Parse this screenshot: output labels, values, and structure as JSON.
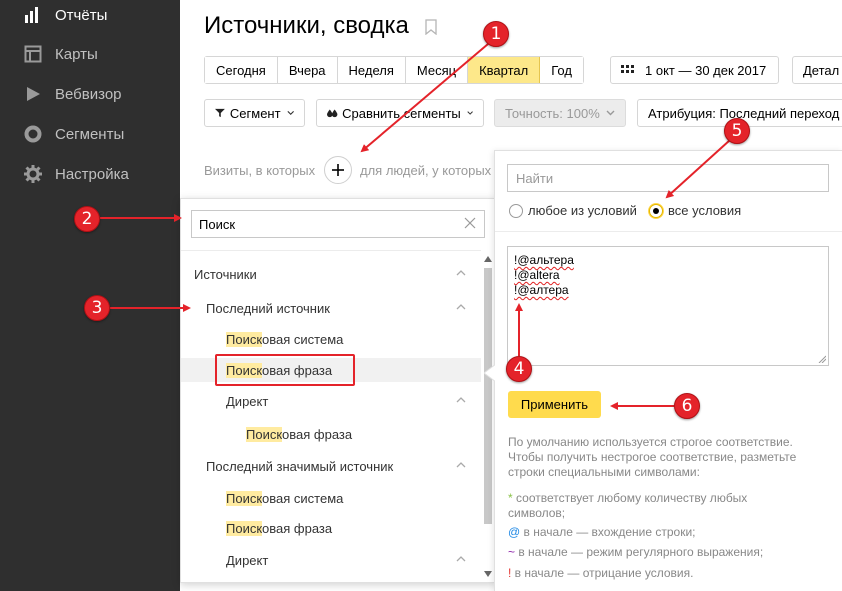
{
  "sidebar": {
    "items": [
      {
        "label": "Отчёты",
        "icon": "bar-chart-icon",
        "active": true
      },
      {
        "label": "Карты",
        "icon": "map-icon",
        "active": false
      },
      {
        "label": "Вебвизор",
        "icon": "play-icon",
        "active": false
      },
      {
        "label": "Сегменты",
        "icon": "pie-icon",
        "active": false
      },
      {
        "label": "Настройка",
        "icon": "gear-icon",
        "active": false
      }
    ]
  },
  "header": {
    "title": "Источники, сводка",
    "periods": [
      "Сегодня",
      "Вчера",
      "Неделя",
      "Месяц",
      "Квартал",
      "Год"
    ],
    "active_period": "Квартал",
    "date_range": "1 окт — 30 дек 2017",
    "detail_label": "Детал"
  },
  "toolbar": {
    "segment_label": "Сегмент",
    "compare_label": "Сравнить сегменты",
    "accuracy_label": "Точность: 100%",
    "attribution_label": "Атрибуция: Последний переход"
  },
  "filter": {
    "visits_caption": "Визиты, в которых",
    "people_caption": "для людей, у которых"
  },
  "dropdown": {
    "search_value": "Поиск",
    "items": [
      {
        "pre": "",
        "match": "",
        "post": "Источники"
      },
      {
        "pre": "",
        "match": "",
        "post": "Последний источник"
      },
      {
        "pre": "",
        "match": "Поиск",
        "post": "овая система"
      },
      {
        "pre": "",
        "match": "Поиск",
        "post": "овая фраза"
      },
      {
        "pre": "",
        "match": "",
        "post": "Директ"
      },
      {
        "pre": "",
        "match": "Поиск",
        "post": "овая фраза"
      },
      {
        "pre": "",
        "match": "",
        "post": "Последний значимый источник"
      },
      {
        "pre": "",
        "match": "Поиск",
        "post": "овая система"
      },
      {
        "pre": "",
        "match": "Поиск",
        "post": "овая фраза"
      },
      {
        "pre": "",
        "match": "",
        "post": "Директ"
      }
    ]
  },
  "panel": {
    "find_placeholder": "Найти",
    "radio_any": "любое из условий",
    "radio_all": "все условия",
    "selected_radio": "все условия",
    "conditions": [
      "!@альтера",
      "!@altera",
      "!@алтера"
    ],
    "apply_label": "Применить",
    "help_intro": "По умолчанию используется строгое соответствие. Чтобы получить нестрогое соответствие, разметьте строки специальными символами:",
    "help_rules": [
      {
        "symbol": "*",
        "text": " соответствует любому количеству любых символов;",
        "color": "#8bc34a"
      },
      {
        "symbol": "@",
        "text": " в начале — вхождение строки;",
        "color": "#1e88e5"
      },
      {
        "symbol": "~",
        "text": " в начале — режим регулярного выражения;",
        "color": "#8e24aa"
      },
      {
        "symbol": "!",
        "text": " в начале — отрицание условия.",
        "color": "#e53935"
      }
    ]
  },
  "annotations": [
    "1",
    "2",
    "3",
    "4",
    "5",
    "6"
  ],
  "colors": {
    "sidebar_bg": "#2f2f2f",
    "accent_yellow": "#ffdb4d",
    "annotation_red": "#e4232a"
  }
}
